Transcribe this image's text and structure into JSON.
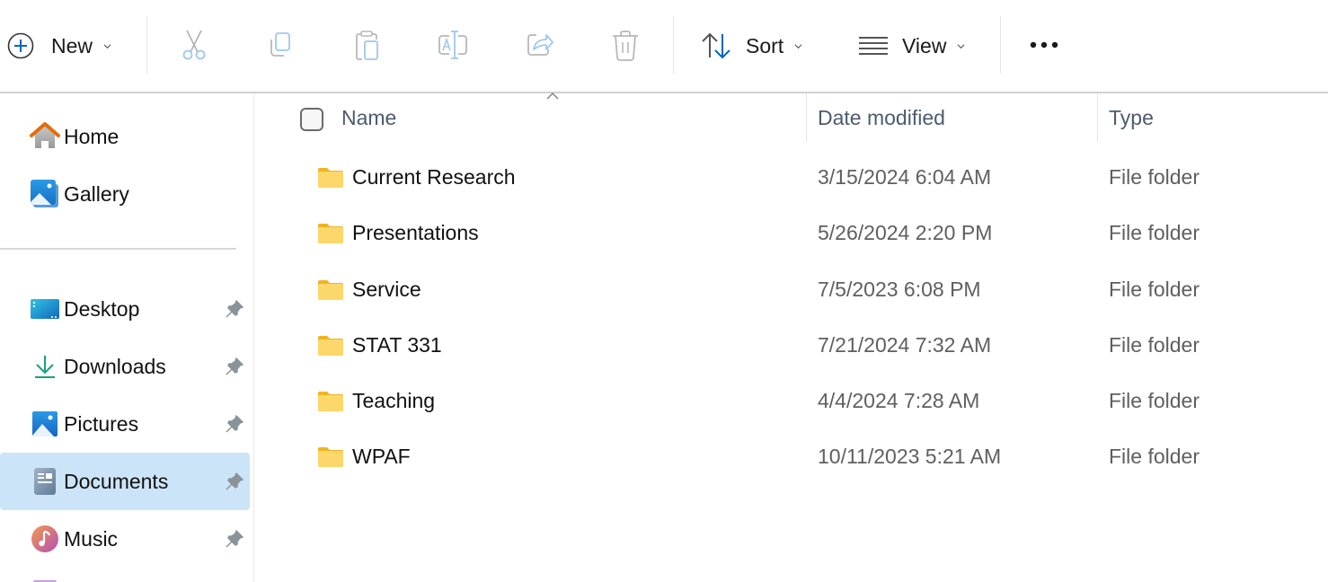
{
  "toolbar": {
    "new_label": "New",
    "sort_label": "Sort",
    "view_label": "View",
    "actions": [
      "cut-icon",
      "copy-icon",
      "paste-icon",
      "rename-icon",
      "share-icon",
      "delete-icon"
    ],
    "more_icon": "more-options-icon"
  },
  "sidebar": {
    "items": [
      {
        "label": "Home",
        "icon": "home-icon",
        "pinned": false,
        "selected": false
      },
      {
        "label": "Gallery",
        "icon": "gallery-icon",
        "pinned": false,
        "selected": false
      },
      {
        "label": "Desktop",
        "icon": "desktop-icon",
        "pinned": true,
        "selected": false
      },
      {
        "label": "Downloads",
        "icon": "downloads-icon",
        "pinned": true,
        "selected": false
      },
      {
        "label": "Pictures",
        "icon": "pictures-icon",
        "pinned": true,
        "selected": false
      },
      {
        "label": "Documents",
        "icon": "documents-icon",
        "pinned": true,
        "selected": true
      },
      {
        "label": "Music",
        "icon": "music-icon",
        "pinned": true,
        "selected": false
      }
    ]
  },
  "file_list": {
    "columns": {
      "name": "Name",
      "date": "Date modified",
      "type": "Type"
    },
    "sort_column": "Name",
    "sort_direction": "ascending",
    "rows": [
      {
        "name": "Current Research",
        "date": "3/15/2024 6:04 AM",
        "type": "File folder"
      },
      {
        "name": "Presentations",
        "date": "5/26/2024 2:20 PM",
        "type": "File folder"
      },
      {
        "name": "Service",
        "date": "7/5/2023 6:08 PM",
        "type": "File folder"
      },
      {
        "name": "STAT 331",
        "date": "7/21/2024 7:32 AM",
        "type": "File folder"
      },
      {
        "name": "Teaching",
        "date": "4/4/2024 7:28 AM",
        "type": "File folder"
      },
      {
        "name": "WPAF",
        "date": "10/11/2023 5:21 AM",
        "type": "File folder"
      }
    ]
  },
  "colors": {
    "accent": "#0067c0",
    "selection": "#cce4f7",
    "folder": "#f8c944",
    "disabled_icon": "#a6a6a6",
    "disabled_accent": "#9fc8ec"
  }
}
